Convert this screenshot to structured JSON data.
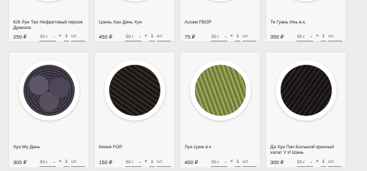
{
  "products": [
    {
      "name": "Юй Лун Тао Нефритовый персик Дракона",
      "price": "250 ₽",
      "weight": "50 г",
      "qty": "1",
      "unit": "шт."
    },
    {
      "name": "Цзинь Хао Дянь Хун",
      "price": "450 ₽",
      "weight": "50 г",
      "qty": "1",
      "unit": "шт."
    },
    {
      "name": "Ассам FBOP",
      "price": "75 ₽",
      "weight": "50 г",
      "qty": "1",
      "unit": "шт."
    },
    {
      "name": "Те Гуань Инь в.к.",
      "price": "350 ₽",
      "weight": "50 г",
      "qty": "1",
      "unit": "шт."
    },
    {
      "name": "Хун Му Дань",
      "price": "300 ₽",
      "weight": "50 г",
      "qty": "1",
      "unit": "шт."
    },
    {
      "name": "Кения FOP",
      "price": "150 ₽",
      "weight": "50 г",
      "qty": "1",
      "unit": "шт."
    },
    {
      "name": "Лун Цзин в.к",
      "price": "400 ₽",
      "weight": "50 г",
      "qty": "1",
      "unit": "шт."
    },
    {
      "name": "Да Хун Пао Большой красный халат У И Шань",
      "price": "300 ₽",
      "weight": "50 г",
      "qty": "1",
      "unit": "шт."
    }
  ],
  "icons": {
    "select": "chevron-down-icon",
    "cart": "add-to-cart-icon"
  },
  "colors": {
    "accent": "#5a9a2f",
    "background": "#ececec"
  }
}
